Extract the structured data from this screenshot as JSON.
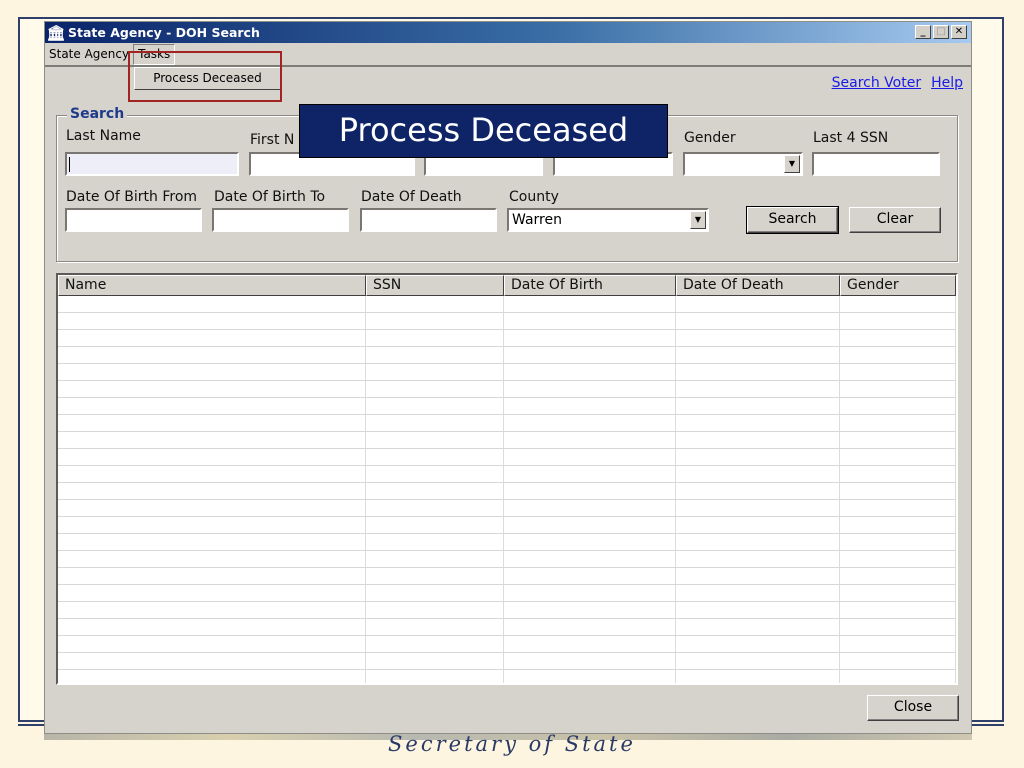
{
  "window": {
    "title": "State Agency - DOH Search",
    "icon": "pillar-icon",
    "controls": {
      "minimize": "_",
      "maximize": "□",
      "close": "✕"
    }
  },
  "menu": {
    "items": [
      {
        "label": "State Agency"
      },
      {
        "label": "Tasks",
        "open": true
      }
    ],
    "dropdown": {
      "items": [
        {
          "label": "Process Deceased"
        }
      ]
    }
  },
  "links": {
    "search_voter": "Search Voter",
    "help": "Help"
  },
  "caption": "Process Deceased",
  "search": {
    "legend": "Search",
    "last_name": {
      "label": "Last Name",
      "value": ""
    },
    "first_name": {
      "label": "First N",
      "value": ""
    },
    "field3": {
      "value": ""
    },
    "field4": {
      "value": ""
    },
    "gender": {
      "label": "Gender",
      "value": ""
    },
    "last4ssn": {
      "label": "Last 4 SSN",
      "value": ""
    },
    "dob_from": {
      "label": "Date Of Birth From",
      "value": ""
    },
    "dob_to": {
      "label": "Date Of Birth To",
      "value": ""
    },
    "dod": {
      "label": "Date Of Death",
      "value": ""
    },
    "county": {
      "label": "County",
      "value": "Warren"
    },
    "search_button": "Search",
    "clear_button": "Clear"
  },
  "results": {
    "columns": [
      "Name",
      "SSN",
      "Date Of Birth",
      "Date Of Death",
      "Gender"
    ],
    "rows": []
  },
  "close_button": "Close",
  "footer": "Secretary of State"
}
